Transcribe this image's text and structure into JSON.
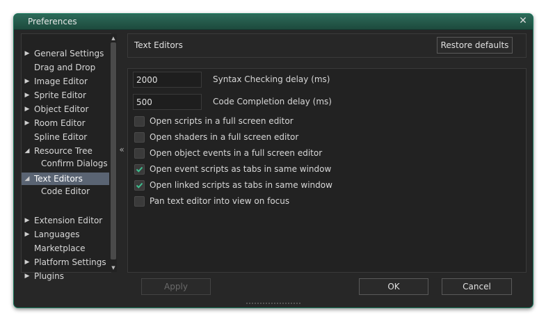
{
  "window": {
    "title": "Preferences"
  },
  "tree": {
    "items": [
      {
        "label": "General Settings",
        "arrow": "right"
      },
      {
        "label": "Drag and Drop",
        "arrow": ""
      },
      {
        "label": "Image Editor",
        "arrow": "right"
      },
      {
        "label": "Sprite Editor",
        "arrow": "right"
      },
      {
        "label": "Object Editor",
        "arrow": "right"
      },
      {
        "label": "Room Editor",
        "arrow": "right"
      },
      {
        "label": "Spline Editor",
        "arrow": ""
      },
      {
        "label": "Resource Tree",
        "arrow": "expanded"
      },
      {
        "label": "Confirm Dialogs",
        "arrow": ""
      },
      {
        "label": "Text Editors",
        "arrow": "expanded",
        "selected": true
      },
      {
        "label": "Code Editor",
        "arrow": ""
      },
      {
        "label": "Extension Editor",
        "arrow": "right"
      },
      {
        "label": "Languages",
        "arrow": "right"
      },
      {
        "label": "Marketplace",
        "arrow": ""
      },
      {
        "label": "Platform Settings",
        "arrow": "right"
      },
      {
        "label": "Plugins",
        "arrow": "right"
      }
    ]
  },
  "collapse_symbol": "«",
  "panel": {
    "title": "Text Editors",
    "restore_label": "Restore defaults"
  },
  "fields": {
    "syntax_value": "2000",
    "syntax_label": "Syntax Checking delay (ms)",
    "completion_value": "500",
    "completion_label": "Code Completion delay (ms)"
  },
  "checkboxes": [
    {
      "label": "Open scripts in a full screen editor",
      "checked": false
    },
    {
      "label": "Open shaders in a full screen editor",
      "checked": false
    },
    {
      "label": "Open object events in a full screen editor",
      "checked": false
    },
    {
      "label": "Open event scripts as tabs in same window",
      "checked": true
    },
    {
      "label": "Open linked scripts as tabs in same window",
      "checked": true
    },
    {
      "label": "Pan text editor into view on focus",
      "checked": false
    }
  ],
  "footer": {
    "apply_label": "Apply",
    "ok_label": "OK",
    "cancel_label": "Cancel"
  },
  "colors": {
    "accent": "#1a7a5e",
    "check": "#3fbf8f",
    "selection": "#5a6473"
  }
}
